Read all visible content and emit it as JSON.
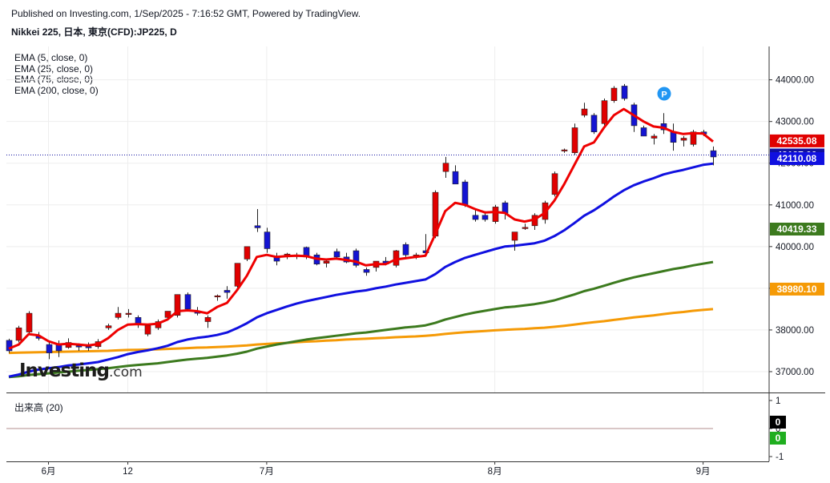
{
  "header": {
    "published": "Published on Investing.com, 1/Sep/2025 - 7:16:52 GMT, Powered by TradingView.",
    "symbol": "Nikkei 225, 日本, 東京(CFD):JP225, D"
  },
  "legend": [
    "EMA (5, close, 0)",
    "EMA (25, close, 0)",
    "EMA (75, close, 0)",
    "EMA (200, close, 0)"
  ],
  "volume_title": "出来高 (20)",
  "logo": {
    "main": "Investing",
    "suffix": ".com"
  },
  "colors": {
    "up": "#e00000",
    "down": "#1414d2",
    "ema5": "#ee0000",
    "ema25": "#1010e0",
    "ema75": "#3c7a1e",
    "ema200": "#f59a06",
    "grid": "#eeeeee",
    "last": "#1010a0"
  },
  "chart_data": {
    "type": "candlestick",
    "ylim": [
      36500,
      44800
    ],
    "yticks": [
      37000,
      38000,
      39000,
      40000,
      41000,
      42000,
      43000,
      44000
    ],
    "ytick_labels": [
      "37000.00",
      "38000.00",
      "39000.00",
      "40000.00",
      "41000.00",
      "42000.00",
      "43000.00",
      "44000.00"
    ],
    "x_labels": [
      {
        "label": "6月",
        "index": 4
      },
      {
        "label": "12",
        "index": 12
      },
      {
        "label": "7月",
        "index": 26
      },
      {
        "label": "8月",
        "index": 49
      },
      {
        "label": "9月",
        "index": 70
      }
    ],
    "candles": [
      {
        "o": 37750,
        "h": 37790,
        "l": 37450,
        "c": 37500
      },
      {
        "o": 37750,
        "h": 38100,
        "l": 37700,
        "c": 38050
      },
      {
        "o": 37950,
        "h": 38450,
        "l": 37900,
        "c": 38400
      },
      {
        "o": 37850,
        "h": 37950,
        "l": 37750,
        "c": 37800
      },
      {
        "o": 37650,
        "h": 37700,
        "l": 37300,
        "c": 37450
      },
      {
        "o": 37650,
        "h": 37750,
        "l": 37350,
        "c": 37500
      },
      {
        "o": 37580,
        "h": 37800,
        "l": 37550,
        "c": 37700
      },
      {
        "o": 37620,
        "h": 37680,
        "l": 37500,
        "c": 37600
      },
      {
        "o": 37600,
        "h": 37700,
        "l": 37500,
        "c": 37580
      },
      {
        "o": 37600,
        "h": 37780,
        "l": 37550,
        "c": 37720
      },
      {
        "o": 38050,
        "h": 38150,
        "l": 38000,
        "c": 38100
      },
      {
        "o": 38300,
        "h": 38550,
        "l": 38250,
        "c": 38400
      },
      {
        "o": 38400,
        "h": 38500,
        "l": 38300,
        "c": 38400
      },
      {
        "o": 38300,
        "h": 38350,
        "l": 38050,
        "c": 38150
      },
      {
        "o": 37900,
        "h": 38100,
        "l": 37850,
        "c": 38100
      },
      {
        "o": 38050,
        "h": 38250,
        "l": 38000,
        "c": 38200
      },
      {
        "o": 38300,
        "h": 38450,
        "l": 38250,
        "c": 38450
      },
      {
        "o": 38350,
        "h": 38850,
        "l": 38300,
        "c": 38850
      },
      {
        "o": 38850,
        "h": 38900,
        "l": 38450,
        "c": 38500
      },
      {
        "o": 38450,
        "h": 38550,
        "l": 38350,
        "c": 38400
      },
      {
        "o": 38200,
        "h": 38350,
        "l": 38050,
        "c": 38300
      },
      {
        "o": 38800,
        "h": 38850,
        "l": 38700,
        "c": 38820
      },
      {
        "o": 38950,
        "h": 39050,
        "l": 38750,
        "c": 38900
      },
      {
        "o": 39050,
        "h": 39600,
        "l": 39000,
        "c": 39600
      },
      {
        "o": 39700,
        "h": 40000,
        "l": 39650,
        "c": 40000
      },
      {
        "o": 40500,
        "h": 40900,
        "l": 40350,
        "c": 40450
      },
      {
        "o": 40350,
        "h": 40450,
        "l": 39850,
        "c": 39950
      },
      {
        "o": 39750,
        "h": 39850,
        "l": 39550,
        "c": 39650
      },
      {
        "o": 39800,
        "h": 39850,
        "l": 39700,
        "c": 39820
      },
      {
        "o": 39800,
        "h": 39850,
        "l": 39700,
        "c": 39800
      },
      {
        "o": 39980,
        "h": 40000,
        "l": 39700,
        "c": 39750
      },
      {
        "o": 39800,
        "h": 39850,
        "l": 39550,
        "c": 39580
      },
      {
        "o": 39600,
        "h": 39700,
        "l": 39500,
        "c": 39650
      },
      {
        "o": 39880,
        "h": 39950,
        "l": 39700,
        "c": 39750
      },
      {
        "o": 39750,
        "h": 39850,
        "l": 39600,
        "c": 39630
      },
      {
        "o": 39900,
        "h": 39950,
        "l": 39500,
        "c": 39550
      },
      {
        "o": 39450,
        "h": 39500,
        "l": 39300,
        "c": 39380
      },
      {
        "o": 39500,
        "h": 39650,
        "l": 39400,
        "c": 39650
      },
      {
        "o": 39650,
        "h": 39750,
        "l": 39550,
        "c": 39580
      },
      {
        "o": 39550,
        "h": 39920,
        "l": 39500,
        "c": 39900
      },
      {
        "o": 40050,
        "h": 40100,
        "l": 39750,
        "c": 39800
      },
      {
        "o": 39750,
        "h": 39850,
        "l": 39700,
        "c": 39800
      },
      {
        "o": 39900,
        "h": 40300,
        "l": 39800,
        "c": 39850
      },
      {
        "o": 40250,
        "h": 41350,
        "l": 40200,
        "c": 41300
      },
      {
        "o": 41800,
        "h": 42150,
        "l": 41650,
        "c": 42000
      },
      {
        "o": 41800,
        "h": 41950,
        "l": 41550,
        "c": 41500
      },
      {
        "o": 41550,
        "h": 41600,
        "l": 40950,
        "c": 41000
      },
      {
        "o": 40750,
        "h": 40900,
        "l": 40600,
        "c": 40650
      },
      {
        "o": 40750,
        "h": 40850,
        "l": 40600,
        "c": 40650
      },
      {
        "o": 40600,
        "h": 41000,
        "l": 40550,
        "c": 40950
      },
      {
        "o": 41050,
        "h": 41100,
        "l": 40650,
        "c": 40800
      },
      {
        "o": 40150,
        "h": 40350,
        "l": 39900,
        "c": 40350
      },
      {
        "o": 40450,
        "h": 40550,
        "l": 40400,
        "c": 40460
      },
      {
        "o": 40500,
        "h": 40800,
        "l": 40400,
        "c": 40750
      },
      {
        "o": 40650,
        "h": 41100,
        "l": 40550,
        "c": 41050
      },
      {
        "o": 41250,
        "h": 41800,
        "l": 41200,
        "c": 41750
      },
      {
        "o": 42300,
        "h": 42350,
        "l": 42250,
        "c": 42320
      },
      {
        "o": 42250,
        "h": 42950,
        "l": 42200,
        "c": 42850
      },
      {
        "o": 43150,
        "h": 43450,
        "l": 43100,
        "c": 43300
      },
      {
        "o": 43150,
        "h": 43200,
        "l": 42700,
        "c": 42750
      },
      {
        "o": 42950,
        "h": 43550,
        "l": 42900,
        "c": 43500
      },
      {
        "o": 43500,
        "h": 43850,
        "l": 43450,
        "c": 43800
      },
      {
        "o": 43850,
        "h": 43900,
        "l": 43500,
        "c": 43550
      },
      {
        "o": 43400,
        "h": 43450,
        "l": 42750,
        "c": 42900
      },
      {
        "o": 42850,
        "h": 42900,
        "l": 42650,
        "c": 42650
      },
      {
        "o": 42600,
        "h": 42700,
        "l": 42450,
        "c": 42650
      },
      {
        "o": 42950,
        "h": 43200,
        "l": 42700,
        "c": 42800
      },
      {
        "o": 42750,
        "h": 42950,
        "l": 42300,
        "c": 42500
      },
      {
        "o": 42550,
        "h": 42650,
        "l": 42400,
        "c": 42600
      },
      {
        "o": 42450,
        "h": 42800,
        "l": 42400,
        "c": 42750
      },
      {
        "o": 42750,
        "h": 42800,
        "l": 42650,
        "c": 42700
      },
      {
        "o": 42300,
        "h": 42400,
        "l": 41950,
        "c": 42150
      }
    ],
    "ema5": [
      37550,
      37650,
      37900,
      37870,
      37730,
      37650,
      37670,
      37650,
      37630,
      37660,
      37800,
      38000,
      38130,
      38140,
      38130,
      38150,
      38250,
      38450,
      38470,
      38450,
      38400,
      38550,
      38650,
      38950,
      39300,
      39750,
      39800,
      39750,
      39770,
      39780,
      39770,
      39710,
      39690,
      39710,
      39680,
      39640,
      39550,
      39580,
      39580,
      39690,
      39720,
      39750,
      39780,
      40300,
      40850,
      41050,
      41000,
      40900,
      40820,
      40830,
      40810,
      40650,
      40600,
      40650,
      40800,
      41100,
      41500,
      41950,
      42400,
      42500,
      42850,
      43150,
      43300,
      43150,
      43000,
      42880,
      42850,
      42750,
      42700,
      42720,
      42710,
      42520
    ],
    "ema25": [
      36880,
      36930,
      37000,
      37050,
      37080,
      37110,
      37150,
      37170,
      37200,
      37230,
      37290,
      37350,
      37420,
      37470,
      37510,
      37560,
      37620,
      37710,
      37770,
      37810,
      37840,
      37880,
      37940,
      38040,
      38160,
      38300,
      38400,
      38480,
      38560,
      38630,
      38690,
      38740,
      38790,
      38840,
      38880,
      38920,
      38950,
      39000,
      39040,
      39090,
      39130,
      39170,
      39210,
      39340,
      39510,
      39630,
      39730,
      39800,
      39870,
      39940,
      40000,
      40020,
      40050,
      40080,
      40140,
      40250,
      40390,
      40560,
      40740,
      40870,
      41030,
      41200,
      41350,
      41470,
      41560,
      41640,
      41730,
      41790,
      41840,
      41900,
      41960,
      41990
    ],
    "ema75": [
      36870,
      36890,
      36920,
      36940,
      36960,
      36980,
      37000,
      37020,
      37040,
      37060,
      37080,
      37110,
      37140,
      37160,
      37180,
      37200,
      37230,
      37260,
      37290,
      37310,
      37330,
      37360,
      37390,
      37430,
      37480,
      37550,
      37600,
      37650,
      37690,
      37730,
      37770,
      37800,
      37830,
      37860,
      37890,
      37920,
      37940,
      37970,
      38000,
      38030,
      38060,
      38080,
      38110,
      38170,
      38250,
      38310,
      38370,
      38420,
      38460,
      38500,
      38540,
      38560,
      38590,
      38620,
      38660,
      38710,
      38780,
      38850,
      38930,
      38990,
      39060,
      39130,
      39200,
      39260,
      39310,
      39360,
      39410,
      39460,
      39500,
      39550,
      39590,
      39630
    ],
    "ema200": [
      37450,
      37455,
      37460,
      37465,
      37470,
      37475,
      37480,
      37485,
      37490,
      37495,
      37500,
      37510,
      37520,
      37525,
      37530,
      37535,
      37545,
      37555,
      37565,
      37575,
      37580,
      37590,
      37600,
      37615,
      37630,
      37650,
      37665,
      37680,
      37690,
      37705,
      37720,
      37730,
      37745,
      37755,
      37770,
      37780,
      37790,
      37800,
      37810,
      37825,
      37835,
      37845,
      37860,
      37880,
      37905,
      37925,
      37945,
      37960,
      37975,
      37990,
      38005,
      38015,
      38025,
      38040,
      38055,
      38075,
      38100,
      38130,
      38160,
      38185,
      38210,
      38240,
      38270,
      38300,
      38325,
      38350,
      38380,
      38410,
      38430,
      38460,
      38480,
      38500
    ],
    "price_labels": [
      {
        "value": 42535.08,
        "text": "42535.08",
        "color": "#e00000"
      },
      {
        "value": 42197.0,
        "text": "42197.00",
        "color": "#1010a0"
      },
      {
        "value": 42110.08,
        "text": "42110.08",
        "color": "#1010e0"
      },
      {
        "value": 40419.33,
        "text": "40419.33",
        "color": "#3c7a1e"
      },
      {
        "value": 38980.1,
        "text": "38980.10",
        "color": "#f59a06"
      }
    ],
    "last_price": 42197.0,
    "volume": {
      "ylim": [
        -1,
        1
      ],
      "ytick_labels": [
        "1",
        "0",
        "-1"
      ],
      "value_labels": [
        {
          "text": "0",
          "color": "#000000"
        },
        {
          "text": "0",
          "color": "#1fae1f"
        }
      ]
    },
    "marker": "P"
  }
}
